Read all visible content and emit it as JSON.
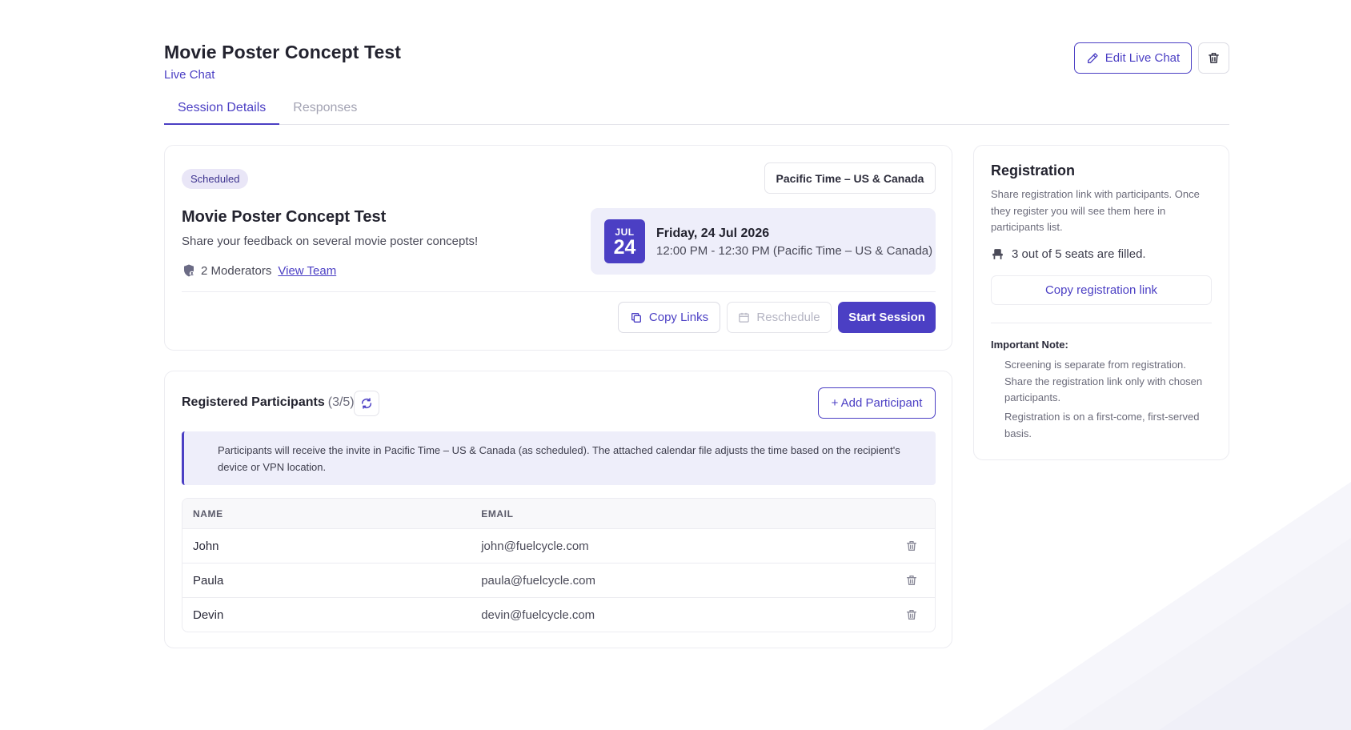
{
  "header": {
    "title": "Movie Poster Concept Test",
    "subtitle": "Live Chat",
    "edit_label": "Edit Live Chat"
  },
  "tabs": [
    {
      "label": "Session Details",
      "active": true
    },
    {
      "label": "Responses",
      "active": false
    }
  ],
  "session": {
    "status": "Scheduled",
    "timezone": "Pacific Time – US & Canada",
    "title": "Movie Poster Concept Test",
    "description": "Share your feedback on several movie poster concepts!",
    "moderators_text": "2 Moderators",
    "view_team_label": "View Team",
    "date": {
      "month": "JUL",
      "day": "24",
      "full_date": "Friday, 24 Jul 2026",
      "time_range": "12:00 PM - 12:30 PM (Pacific Time – US & Canada)"
    },
    "actions": {
      "copy_links": "Copy Links",
      "reschedule": "Reschedule",
      "start_session": "Start Session"
    }
  },
  "participants": {
    "title": "Registered Participants",
    "count": "(3/5)",
    "add_label": "+ Add Participant",
    "info": "Participants will receive the invite in Pacific Time – US & Canada (as scheduled). The attached calendar file adjusts the time based on the recipient's device or VPN location.",
    "columns": {
      "name": "NAME",
      "email": "EMAIL"
    },
    "rows": [
      {
        "name": "John",
        "email": "john@fuelcycle.com"
      },
      {
        "name": "Paula",
        "email": "paula@fuelcycle.com"
      },
      {
        "name": "Devin",
        "email": "devin@fuelcycle.com"
      }
    ]
  },
  "registration": {
    "title": "Registration",
    "description": "Share registration link with participants. Once they register you will see them here in participants list.",
    "seats_text": "3 out of 5 seats are filled.",
    "copy_link_label": "Copy registration link",
    "note_title": "Important Note:",
    "notes": [
      "Screening is separate from registration. Share the registration link only with chosen participants.",
      "Registration is on a first-come, first-served basis."
    ]
  },
  "colors": {
    "accent": "#4b3fc4",
    "accent_light": "#eeeefa",
    "badge_bg": "#e9e6f7",
    "border": "#ececf1"
  },
  "icons": [
    "pencil-icon",
    "trash-icon",
    "copy-icon",
    "calendar-icon",
    "refresh-icon",
    "team-icon",
    "seat-icon"
  ]
}
